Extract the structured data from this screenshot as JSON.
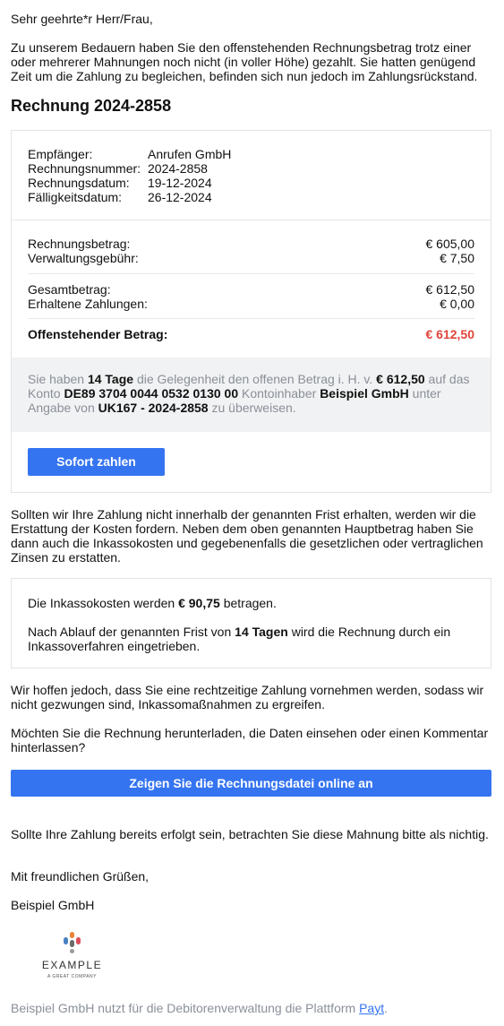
{
  "greeting": "Sehr geehrte*r Herr/Frau,",
  "intro": "Zu unserem Bedauern haben Sie den offenstehenden Rechnungsbetrag trotz einer oder mehrerer Mahnungen noch nicht (in voller Höhe) gezahlt. Sie hatten genügend Zeit um die Zahlung zu begleichen, befinden sich nun jedoch im Zahlungsrückstand.",
  "invoice_title": "Rechnung 2024-2858",
  "meta": [
    {
      "label": "Empfänger:",
      "value": "Anrufen GmbH"
    },
    {
      "label": "Rechnungsnummer:",
      "value": "2024-2858"
    },
    {
      "label": "Rechnungsdatum:",
      "value": "19-12-2024"
    },
    {
      "label": "Fälligkeitsdatum:",
      "value": "26-12-2024"
    }
  ],
  "amounts": {
    "invoice_label": "Rechnungsbetrag:",
    "invoice_value": "€ 605,00",
    "fee_label": "Verwaltungsgebühr:",
    "fee_value": "€ 7,50",
    "total_label": "Gesamtbetrag:",
    "total_value": "€ 612,50",
    "received_label": "Erhaltene Zahlungen:",
    "received_value": "€ 0,00",
    "outstanding_label": "Offenstehender Betrag:",
    "outstanding_value": "€ 612,50"
  },
  "notice": {
    "t1": "Sie haben ",
    "days": "14 Tage",
    "t2": " die Gelegenheit den offenen Betrag i. H. v. ",
    "amount": "€ 612,50",
    "t3": " auf das Konto ",
    "iban": "DE89 3704 0044 0532 0130 00",
    "t4": " Kontoinhaber ",
    "holder": "Beispiel GmbH",
    "t5": " unter Angabe von ",
    "reference": "UK167 - 2024-2858",
    "t6": " zu überweisen."
  },
  "pay_button": "Sofort zahlen",
  "warning": "Sollten wir Ihre Zahlung nicht innerhalb der genannten Frist erhalten, werden wir die Erstattung der Kosten fordern. Neben dem oben genannten Hauptbetrag haben Sie dann auch die Inkassokosten und gegebenenfalls die gesetzlichen oder vertraglichen Zinsen zu erstatten.",
  "collection": {
    "c1": "Die Inkassokosten werden ",
    "cost": "€ 90,75",
    "c2": " betragen.",
    "d1": "Nach Ablauf der genannten Frist von ",
    "days": "14 Tagen",
    "d2": " wird die Rechnung durch ein Inkassoverfahren eingetrieben."
  },
  "hope": "Wir hoffen jedoch, dass Sie eine rechtzeitige Zahlung vornehmen werden, sodass wir nicht gezwungen sind, Inkassomaßnahmen zu ergreifen.",
  "question": "Möchten Sie die Rechnung herunterladen, die Daten einsehen oder einen Kommentar hinterlassen?",
  "view_button": "Zeigen Sie die Rechnungsdatei online an",
  "paid_note": "Sollte Ihre Zahlung bereits erfolgt sein, betrachten Sie diese Mahnung bitte als nichtig.",
  "closing": "Mit freundlichen Grüßen,",
  "signature": "Beispiel GmbH",
  "logo": {
    "word": "EXAMPLE",
    "tagline": "A GREAT COMPANY"
  },
  "footer": {
    "text": "Beispiel GmbH nutzt für die Debitorenverwaltung die Plattform ",
    "link": "Payt",
    "end": "."
  },
  "colors": {
    "accent": "#3574f0",
    "danger": "#e0443a",
    "muted": "#8a8f98"
  }
}
